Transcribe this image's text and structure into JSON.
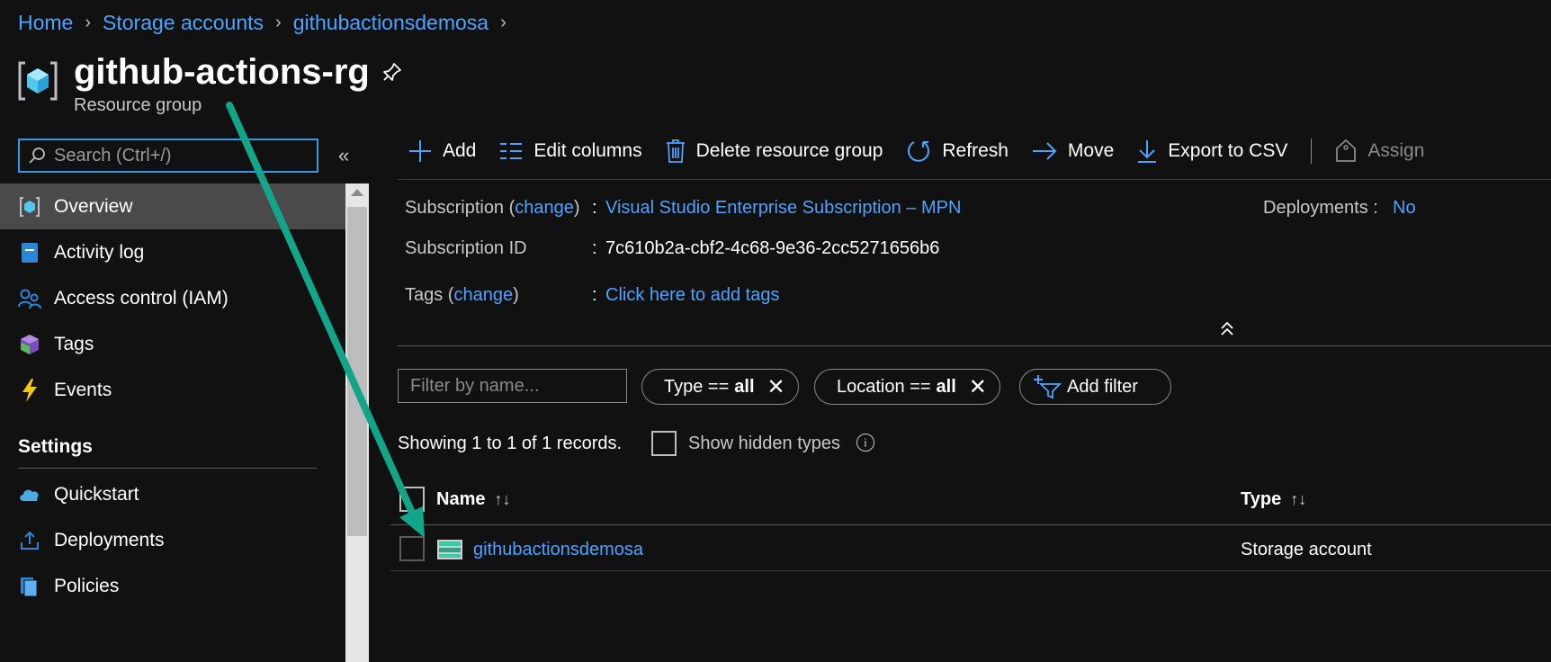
{
  "breadcrumb": {
    "items": [
      "Home",
      "Storage accounts",
      "githubactionsdemosa"
    ]
  },
  "header": {
    "title": "github-actions-rg",
    "subtitle": "Resource group"
  },
  "sidebar": {
    "search_placeholder": "Search (Ctrl+/)",
    "items": [
      {
        "label": "Overview",
        "icon": "resource-group-icon",
        "active": true
      },
      {
        "label": "Activity log",
        "icon": "activity-log-icon"
      },
      {
        "label": "Access control (IAM)",
        "icon": "people-icon"
      },
      {
        "label": "Tags",
        "icon": "tag-icon"
      },
      {
        "label": "Events",
        "icon": "lightning-icon"
      }
    ],
    "section_title": "Settings",
    "settings_items": [
      {
        "label": "Quickstart",
        "icon": "cloud-icon"
      },
      {
        "label": "Deployments",
        "icon": "upload-icon"
      },
      {
        "label": "Policies",
        "icon": "policy-icon"
      }
    ]
  },
  "toolbar": {
    "add": "Add",
    "edit_columns": "Edit columns",
    "delete_rg": "Delete resource group",
    "refresh": "Refresh",
    "move": "Move",
    "export": "Export to CSV",
    "assign": "Assign"
  },
  "essentials": {
    "subscription_label": "Subscription",
    "change": "change",
    "subscription_value": "Visual Studio Enterprise Subscription – MPN",
    "subscription_id_label": "Subscription ID",
    "subscription_id_value": "7c610b2a-cbf2-4c68-9e36-2cc5271656b6",
    "tags_label": "Tags",
    "tags_value": "Click here to add tags",
    "deployments_label": "Deployments",
    "deployments_value": "No"
  },
  "filters": {
    "filter_placeholder": "Filter by name...",
    "type_label": "Type ==",
    "type_value": "all",
    "location_label": "Location ==",
    "location_value": "all",
    "add_filter": "Add filter"
  },
  "records": {
    "text": "Showing 1 to 1 of 1 records.",
    "show_hidden": "Show hidden types"
  },
  "table": {
    "columns": [
      "Name",
      "Type"
    ],
    "rows": [
      {
        "name": "githubactionsdemosa",
        "type": "Storage account"
      }
    ]
  },
  "colors": {
    "accent": "#4da3ff",
    "arrow": "#12a58a",
    "background": "#111111"
  }
}
